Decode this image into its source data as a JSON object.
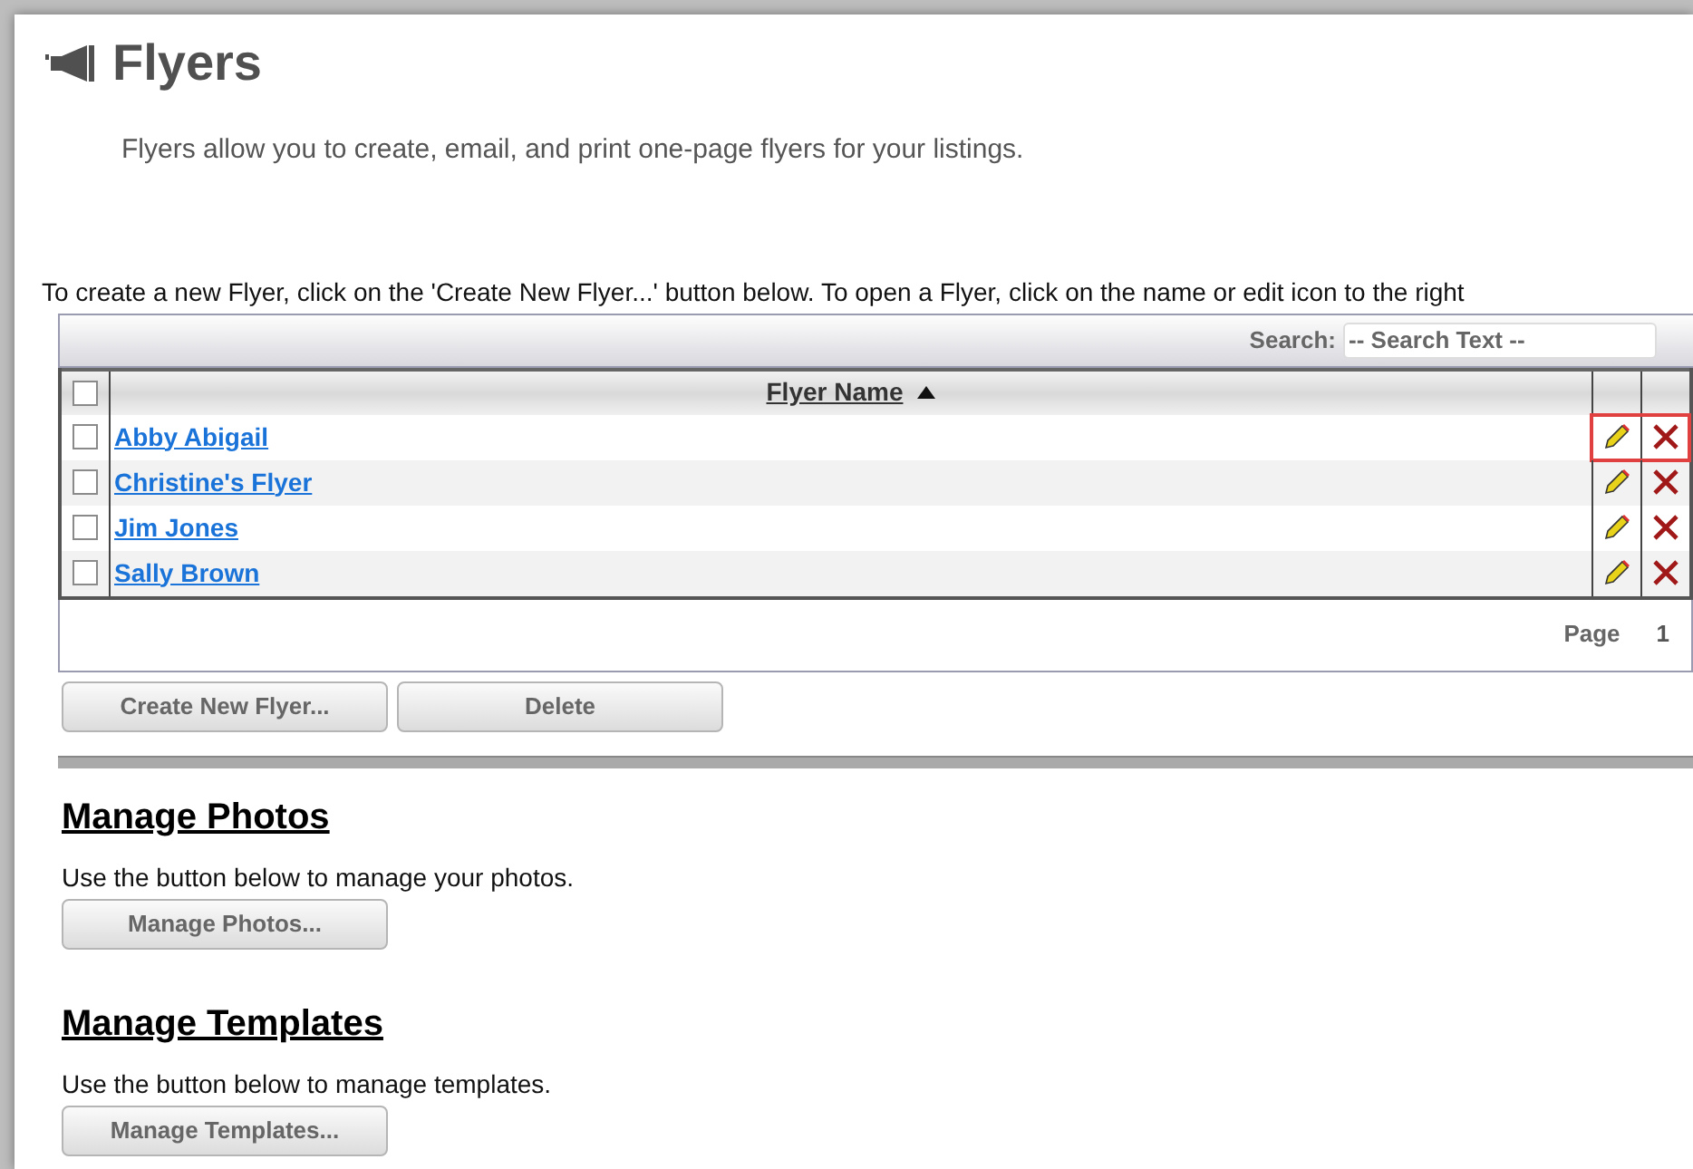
{
  "page": {
    "title": "Flyers",
    "description": "Flyers allow you to create, email, and print one-page flyers for your listings.",
    "instructions": "To create a new Flyer, click on the 'Create New Flyer...' button below. To open a Flyer, click on the name or edit icon to the right"
  },
  "table": {
    "search": {
      "label": "Search:",
      "placeholder": "-- Search Text --"
    },
    "select_all": {
      "checked": false
    },
    "column": {
      "label": "Flyer Name",
      "sorted_ascending": true
    },
    "rows": [
      {
        "name": "Abby Abigail",
        "checked": false,
        "highlighted": true
      },
      {
        "name": "Christine's Flyer",
        "checked": false,
        "highlighted": false
      },
      {
        "name": "Jim Jones",
        "checked": false,
        "highlighted": false
      },
      {
        "name": "Sally Brown",
        "checked": false,
        "highlighted": false
      }
    ],
    "pager": {
      "label": "Page",
      "value": "1"
    }
  },
  "buttons": [
    "Create New Flyer...",
    "Delete"
  ],
  "sections": [
    {
      "title": "Manage Photos",
      "text": "Use the button below to manage your photos.",
      "button": "Manage Photos..."
    },
    {
      "title": "Manage Templates",
      "text": "Use the button below to manage templates.",
      "button": "Manage Templates..."
    }
  ]
}
